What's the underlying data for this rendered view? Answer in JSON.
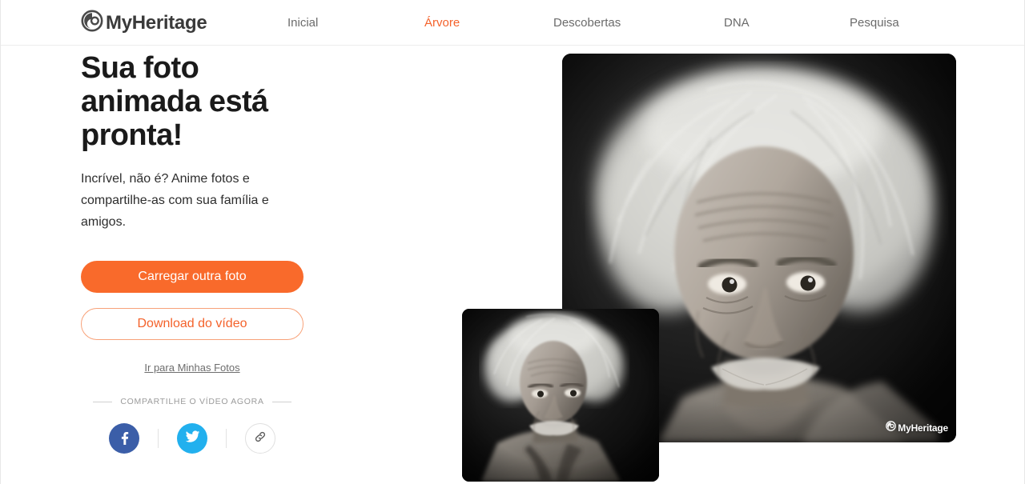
{
  "header": {
    "brand": {
      "name": "MyHeritage",
      "logo_icon": "myheritage-logo-icon"
    },
    "nav": [
      {
        "label": "Inicial",
        "active": false
      },
      {
        "label": "Árvore",
        "active": true
      },
      {
        "label": "Descobertas",
        "active": false
      },
      {
        "label": "DNA",
        "active": false
      },
      {
        "label": "Pesquisa",
        "active": false
      }
    ]
  },
  "main": {
    "headline": "Sua foto animada está pronta!",
    "subtitle": "Incrível, não é? Anime fotos e compartilhe-as com sua família e amigos.",
    "primary_button": "Carregar outra foto",
    "secondary_button": "Download do vídeo",
    "my_photos_link": "Ir para Minhas Fotos",
    "share_label": "COMPARTILHE O VÍDEO AGORA",
    "share_buttons": [
      {
        "name": "facebook",
        "icon": "facebook-icon",
        "color": "#3b5ea8"
      },
      {
        "name": "twitter",
        "icon": "twitter-icon",
        "color": "#22b0ee"
      },
      {
        "name": "copy-link",
        "icon": "link-icon",
        "color": "#6b6b6b"
      }
    ]
  },
  "media": {
    "main_video": {
      "alt": "Foto animada em preto e branco de um homem idoso de cabelo branco despenteado",
      "watermark": "MyHeritage"
    },
    "thumbnail_video": {
      "alt": "Miniatura da foto original em preto e branco"
    }
  },
  "colors": {
    "accent": "#f96a2b",
    "accent_text": "#f4622b",
    "text_primary": "#1a1a1a",
    "text_secondary": "#6b6b6b",
    "background": "#ffffff",
    "border": "#ededed"
  }
}
